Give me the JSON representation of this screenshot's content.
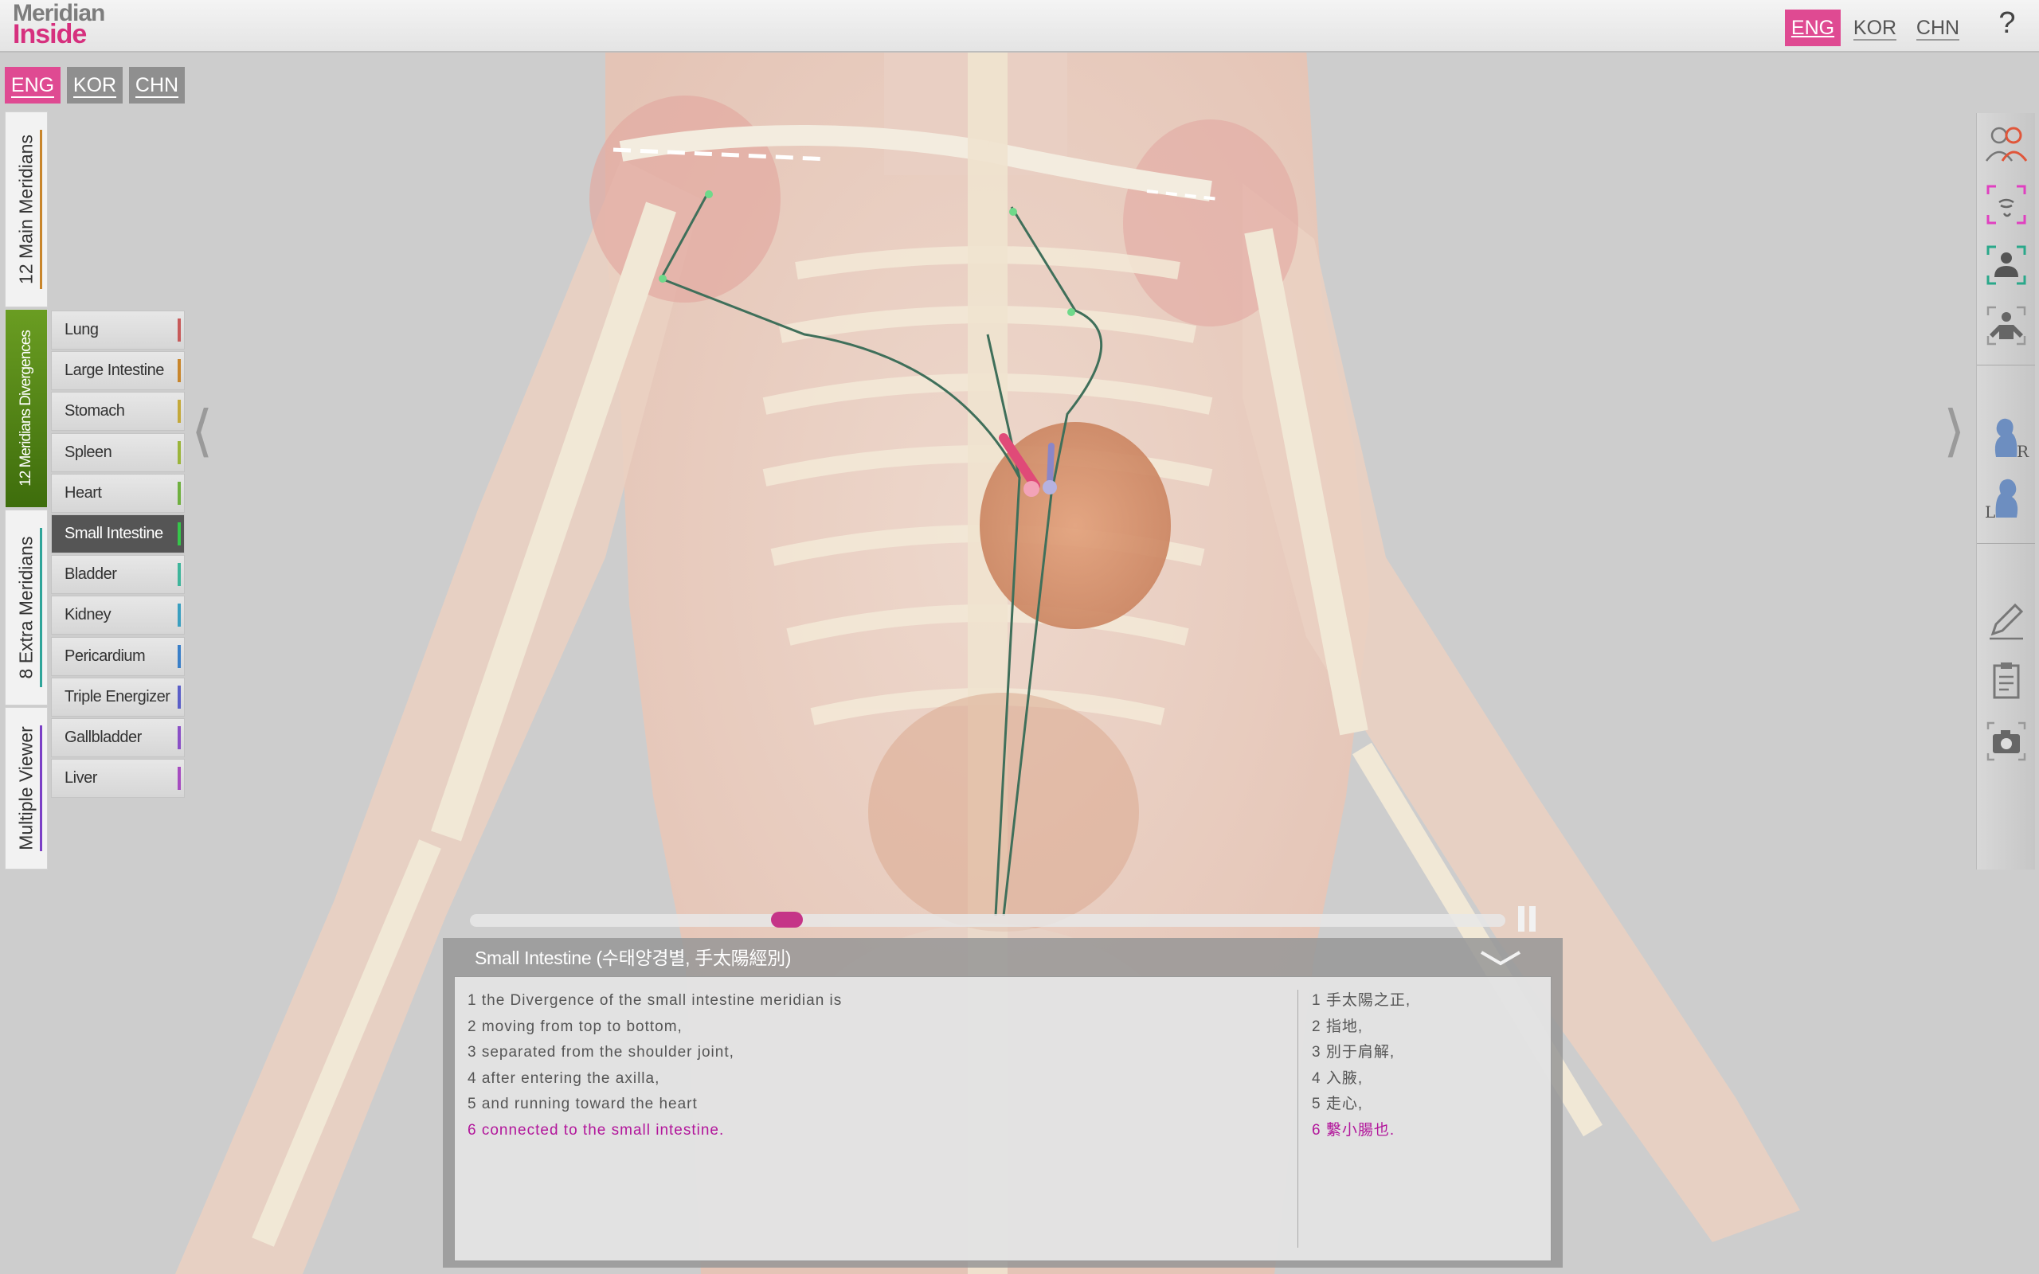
{
  "app": {
    "logo_line1": "Meridian",
    "logo_line2": "Inside"
  },
  "top_lang": {
    "eng": "ENG",
    "kor": "KOR",
    "chn": "CHN",
    "help": "?"
  },
  "sub_lang": {
    "eng": "ENG",
    "kor": "KOR",
    "chn": "CHN"
  },
  "tabs": [
    {
      "label": "12 Main Meridians",
      "color": "#c8852b"
    },
    {
      "label": "12 Meridians Divergences",
      "color": "#6a9d22"
    },
    {
      "label": "8 Extra Meridians",
      "color": "#2fa59a"
    },
    {
      "label": "Multiple Viewer",
      "color": "#7b3fc6"
    }
  ],
  "meridians": [
    {
      "label": "Lung",
      "color": "#c75a5a"
    },
    {
      "label": "Large Intestine",
      "color": "#c8852b"
    },
    {
      "label": "Stomach",
      "color": "#c4a93a"
    },
    {
      "label": "Spleen",
      "color": "#9bb53b"
    },
    {
      "label": "Heart",
      "color": "#6fb040"
    },
    {
      "label": "Small Intestine",
      "color": "#35c74a"
    },
    {
      "label": "Bladder",
      "color": "#3fb59b"
    },
    {
      "label": "Kidney",
      "color": "#3a9fc0"
    },
    {
      "label": "Pericardium",
      "color": "#3a7fc8"
    },
    {
      "label": "Triple Energizer",
      "color": "#5a5ec8"
    },
    {
      "label": "Gallbladder",
      "color": "#8a4fc6"
    },
    {
      "label": "Liver",
      "color": "#a64cc0"
    }
  ],
  "selected_meridian": "Small Intestine",
  "arrows": {
    "left": "⟨",
    "right": "⟩"
  },
  "timeline": {
    "progress": 0.3
  },
  "panel": {
    "title": "Small Intestine (수태양경별, 手太陽經別)",
    "english_lines": [
      "1 the Divergence of the small intestine meridian is",
      "2 moving from top to bottom,",
      "3 separated from the shoulder joint,",
      "4 after entering the axilla,",
      "5 and running toward the heart",
      "6 connected to the small intestine."
    ],
    "chinese_lines": [
      "1 手太陽之正,",
      "2 指地,",
      "3 別于肩解,",
      "4 入腋,",
      "5 走心,",
      "6 繫小腸也."
    ],
    "highlight_line": 6
  },
  "toolbar": {
    "r_label": "R",
    "l_label": "L"
  },
  "colors": {
    "accent": "#df4a92",
    "highlight_text": "#b2169b",
    "tab_active": "#6a9d22"
  }
}
